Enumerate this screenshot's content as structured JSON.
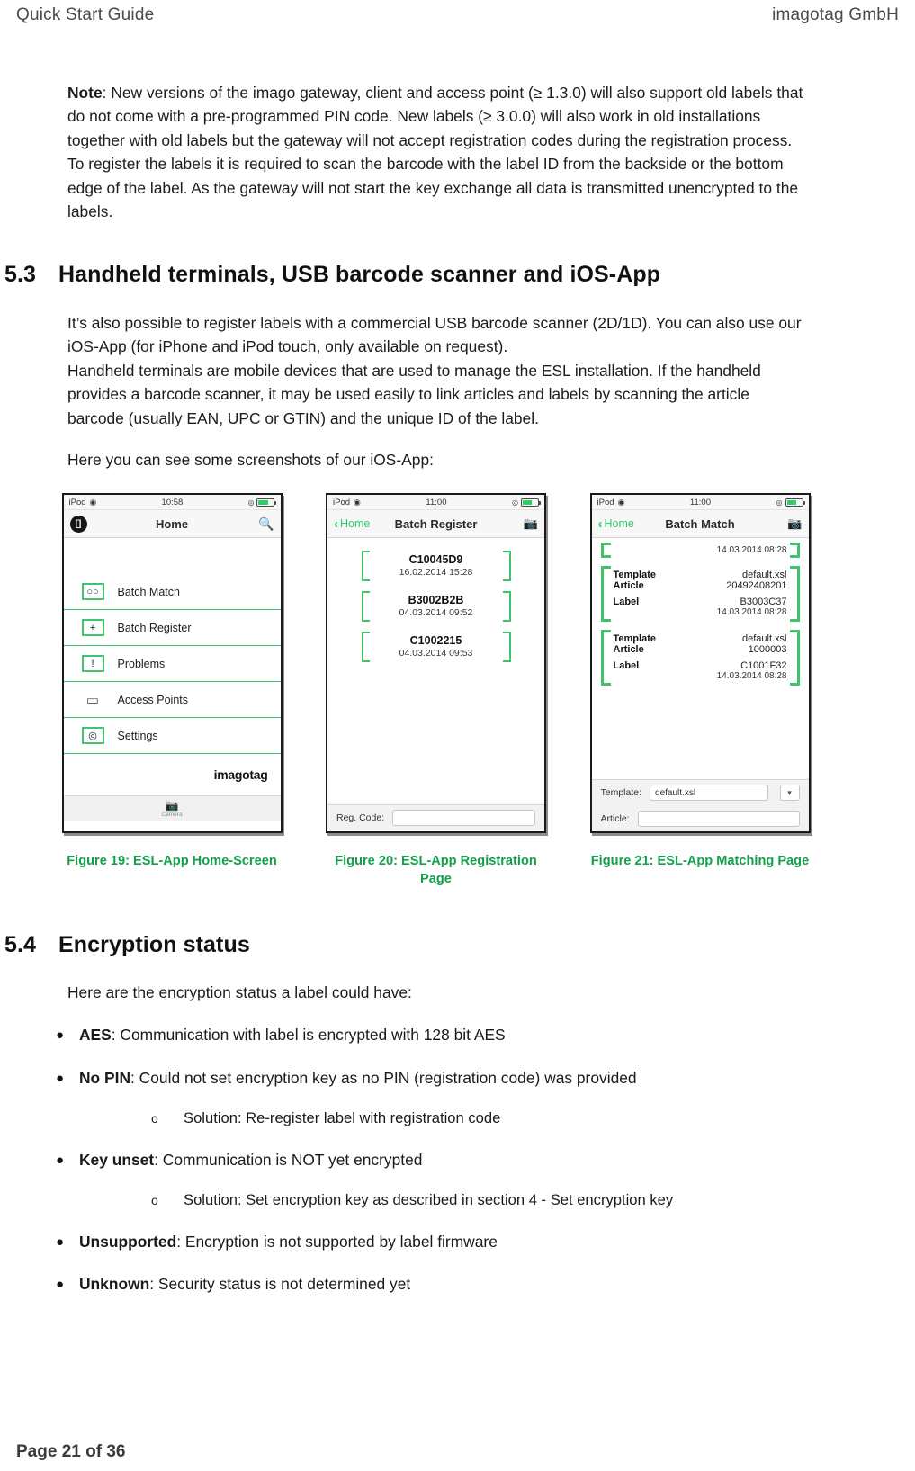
{
  "header": {
    "left": "Quick Start Guide",
    "right": "imagotag GmbH"
  },
  "footer": {
    "page": "Page 21 of 36"
  },
  "note": {
    "label": "Note",
    "body": ": New versions of the imago gateway, client and access point (≥ 1.3.0) will also support old labels that do not come with a pre-programmed PIN code. New labels (≥ 3.0.0) will also work in old installations together with old labels but the gateway will not accept registration codes during the registration process. To register the labels it is required to scan the barcode with the label ID from the backside or the bottom edge of the label. As the gateway will not start the key exchange all data is transmitted unencrypted to the labels."
  },
  "section_53": {
    "number": "5.3",
    "title": "Handheld terminals, USB barcode scanner and iOS-App",
    "para1": "It’s also possible to register labels with a commercial USB barcode scanner (2D/1D). You can also use our iOS-App (for iPhone and iPod touch, only available on request).",
    "para2": "Handheld terminals are mobile devices that are used to manage the ESL installation. If the handheld provides a barcode scanner, it may be used easily to link articles and labels by scanning the article barcode (usually EAN, UPC or GTIN) and the unique ID of the label.",
    "para3": "Here you can see some screenshots of our iOS-App:"
  },
  "figures": [
    {
      "caption": "Figure 19: ESL-App Home-Screen",
      "statusbar": {
        "carrier": "iPod",
        "time": "10:58"
      },
      "navbar": {
        "title": "Home",
        "left_icon": "app-badge",
        "left_label": "[]",
        "right_icon": "search-icon"
      },
      "menu_items": [
        {
          "label": "Batch Match",
          "icon": "pill-icon",
          "glyph": "○○"
        },
        {
          "label": "Batch Register",
          "icon": "plus-icon",
          "glyph": "+"
        },
        {
          "label": "Problems",
          "icon": "exclamation-icon",
          "glyph": "!"
        },
        {
          "label": "Access Points",
          "icon": "access-point-icon",
          "glyph": "▭"
        },
        {
          "label": "Settings",
          "icon": "gear-icon",
          "glyph": "◎"
        }
      ],
      "brand": "imagotag",
      "camera_bar": {
        "icon": "camera-icon",
        "label": "Camera"
      }
    },
    {
      "caption": "Figure 20: ESL-App Registration Page",
      "statusbar": {
        "carrier": "iPod",
        "time": "11:00"
      },
      "navbar": {
        "title": "Batch Register",
        "back_label": "Home",
        "right_icon": "camera-icon"
      },
      "register_items": [
        {
          "code": "C10045D9",
          "date": "16.02.2014 15:28"
        },
        {
          "code": "B3002B2B",
          "date": "04.03.2014 09:52"
        },
        {
          "code": "C1002215",
          "date": "04.03.2014 09:53"
        }
      ],
      "footer_field": {
        "label": "Reg. Code:",
        "value": "",
        "placeholder": ""
      }
    },
    {
      "caption": "Figure 21: ESL-App Matching Page",
      "statusbar": {
        "carrier": "iPod",
        "time": "11:00"
      },
      "navbar": {
        "title": "Batch Match",
        "back_label": "Home",
        "right_icon": "camera-icon"
      },
      "header_date": "14.03.2014 08:28",
      "match_cards": [
        {
          "template_key": "Template",
          "template_val": "default.xsl",
          "article_key": "Article",
          "article_val": "20492408201",
          "label_key": "Label",
          "label_val": "B3003C37",
          "label_date": "14.03.2014 08:28"
        },
        {
          "template_key": "Template",
          "template_val": "default.xsl",
          "article_key": "Article",
          "article_val": "1000003",
          "label_key": "Label",
          "label_val": "C1001F32",
          "label_date": "14.03.2014 08:28"
        }
      ],
      "form": {
        "template_label": "Template:",
        "template_value": "default.xsl",
        "article_label": "Article:",
        "article_value": ""
      }
    }
  ],
  "section_54": {
    "number": "5.4",
    "title": "Encryption status",
    "intro": "Here are the encryption status a label could have:",
    "items": [
      {
        "level": 1,
        "term": "AES",
        "rest": ": Communication with label is encrypted with 128 bit AES"
      },
      {
        "level": 1,
        "term": "No PIN",
        "rest": ": Could not set encryption key as no PIN (registration code) was provided"
      },
      {
        "level": 2,
        "term": "",
        "rest": "Solution: Re-register label with registration code"
      },
      {
        "level": 1,
        "term": "Key  unset",
        "rest": ": Communication is NOT yet encrypted"
      },
      {
        "level": 2,
        "term": "",
        "rest": "Solution: Set encryption key as described in section 4 - Set encryption key"
      },
      {
        "level": 1,
        "term": "Unsupported",
        "rest": ": Encryption is not supported by label firmware"
      },
      {
        "level": 1,
        "term": "Unknown",
        "rest": ": Security status is not determined yet"
      }
    ]
  },
  "colors": {
    "accent_green": "#13a04a",
    "ui_green": "#3fc46a",
    "text": "#1c1c1c"
  }
}
